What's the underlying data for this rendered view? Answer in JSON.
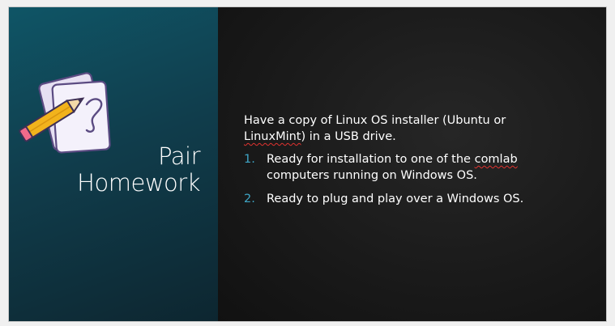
{
  "slide": {
    "title_line1": "Pair",
    "title_line2": "Homework",
    "intro_part1": "Have a copy of Linux OS installer (Ubuntu or ",
    "intro_misspelled": "LinuxMint",
    "intro_part2": ") in a USB drive.",
    "items": [
      {
        "number": "1.",
        "text_part1": "Ready for installation to one of the ",
        "misspelled": "comlab",
        "text_part2": " computers running on Windows OS."
      },
      {
        "number": "2.",
        "text": "Ready to plug and play over a Windows OS."
      }
    ],
    "icon": "notepad-pencil-icon"
  },
  "colors": {
    "left_panel": "#0f4a5a",
    "right_panel": "#1c1c1c",
    "numbering": "#3fa6c6",
    "spellcheck": "#e0322f"
  }
}
